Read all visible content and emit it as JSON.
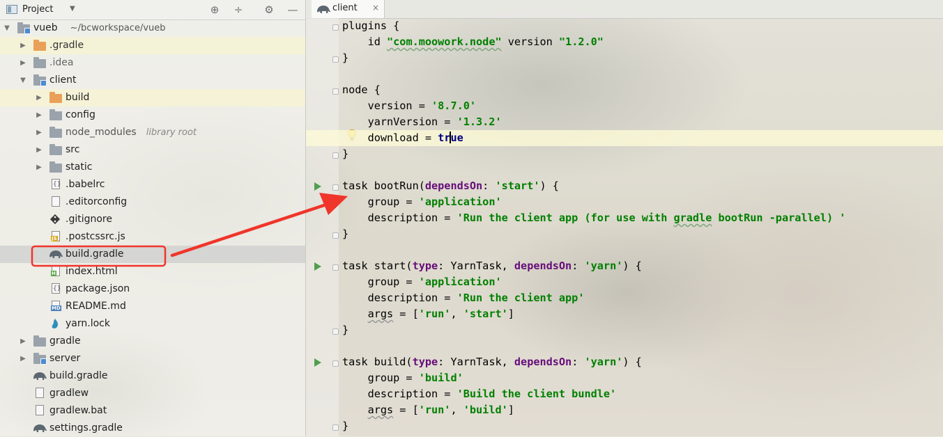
{
  "project_panel": {
    "title": "Project",
    "dropdown": "▼",
    "toolbar_icons": [
      "locate-icon",
      "collapse-icon",
      "gear-icon",
      "hide-icon"
    ],
    "tree": [
      {
        "label": "vueb",
        "sub": "~/bcworkspace/vueb",
        "icon": "module-folder-icon",
        "arrow": "down"
      },
      {
        "label": ".gradle",
        "icon": "folder-orange-icon",
        "arrow": "right"
      },
      {
        "label": ".idea",
        "icon": "folder-icon",
        "arrow": "right"
      },
      {
        "label": "client",
        "icon": "module-folder-icon",
        "arrow": "down"
      },
      {
        "label": "build",
        "icon": "folder-orange-icon",
        "arrow": "right"
      },
      {
        "label": "config",
        "icon": "folder-icon",
        "arrow": "right"
      },
      {
        "label": "node_modules",
        "sub": "library root",
        "icon": "folder-icon",
        "arrow": "right"
      },
      {
        "label": "src",
        "icon": "folder-icon",
        "arrow": "right"
      },
      {
        "label": "static",
        "icon": "folder-icon",
        "arrow": "right"
      },
      {
        "label": ".babelrc",
        "icon": "json-file-icon"
      },
      {
        "label": ".editorconfig",
        "icon": "text-file-icon"
      },
      {
        "label": ".gitignore",
        "icon": "git-icon"
      },
      {
        "label": ".postcssrc.js",
        "icon": "js-file-icon",
        "tag": "JS"
      },
      {
        "label": "build.gradle",
        "icon": "gradle-elephant-icon"
      },
      {
        "label": "index.html",
        "icon": "html-file-icon",
        "tag": "H"
      },
      {
        "label": "package.json",
        "icon": "json-file-icon"
      },
      {
        "label": "README.md",
        "icon": "markdown-file-icon",
        "tag": "MD"
      },
      {
        "label": "yarn.lock",
        "icon": "yarn-icon"
      },
      {
        "label": "gradle",
        "icon": "folder-icon",
        "arrow": "right"
      },
      {
        "label": "server",
        "icon": "module-folder-icon",
        "arrow": "right"
      },
      {
        "label": "build.gradle",
        "icon": "gradle-elephant-icon"
      },
      {
        "label": "gradlew",
        "icon": "text-file-icon"
      },
      {
        "label": "gradlew.bat",
        "icon": "text-file-icon"
      },
      {
        "label": "settings.gradle",
        "icon": "gradle-elephant-icon"
      }
    ]
  },
  "editor": {
    "tab": {
      "label": "client",
      "close": "×",
      "icon": "gradle-elephant-icon"
    },
    "code": {
      "l1": {
        "a": "plugins {"
      },
      "l2": {
        "a": "    id ",
        "b": "\"com.moowork.node\"",
        "c": " version ",
        "d": "\"1.2.0\""
      },
      "l3": {
        "a": "}"
      },
      "l5": {
        "a": "node {"
      },
      "l6": {
        "a": "    version = ",
        "b": "'8.7.0'"
      },
      "l7": {
        "a": "    yarnVersion = ",
        "b": "'1.3.2'"
      },
      "l8": {
        "a": "    download = ",
        "b": "tr",
        "c": "ue"
      },
      "l9": {
        "a": "}"
      },
      "l11": {
        "a": "task bootRun(",
        "b": "dependsOn",
        "c": ": ",
        "d": "'start'",
        "e": ") {"
      },
      "l12": {
        "a": "    group = ",
        "b": "'application'"
      },
      "l13": {
        "a": "    description = ",
        "b": "'Run the client app (for use with ",
        "c": "gradle",
        "d": " bootRun -parallel) '"
      },
      "l14": {
        "a": "}"
      },
      "l16": {
        "a": "task start(",
        "b": "type",
        "c": ": YarnTask, ",
        "d": "dependsOn",
        "e": ": ",
        "f": "'yarn'",
        "g": ") {"
      },
      "l17": {
        "a": "    group = ",
        "b": "'application'"
      },
      "l18": {
        "a": "    description = ",
        "b": "'Run the client app'"
      },
      "l19": {
        "a": "    ",
        "b": "args",
        "c": " = [",
        "d": "'run'",
        "e": ", ",
        "f": "'start'",
        "g": "]"
      },
      "l20": {
        "a": "}"
      },
      "l22": {
        "a": "task build(",
        "b": "type",
        "c": ": YarnTask, ",
        "d": "dependsOn",
        "e": ": ",
        "f": "'yarn'",
        "g": ") {"
      },
      "l23": {
        "a": "    group = ",
        "b": "'build'"
      },
      "l24": {
        "a": "    description = ",
        "b": "'Build the client bundle'"
      },
      "l25": {
        "a": "    ",
        "b": "args",
        "c": " = [",
        "d": "'run'",
        "e": ", ",
        "f": "'build'",
        "g": "]"
      },
      "l26": {
        "a": "}"
      }
    }
  },
  "colors": {
    "annotation_red": "#f0352a",
    "string_green": "#008000",
    "keyword_purple": "#660e7a",
    "run_green": "#4f9f4f"
  }
}
